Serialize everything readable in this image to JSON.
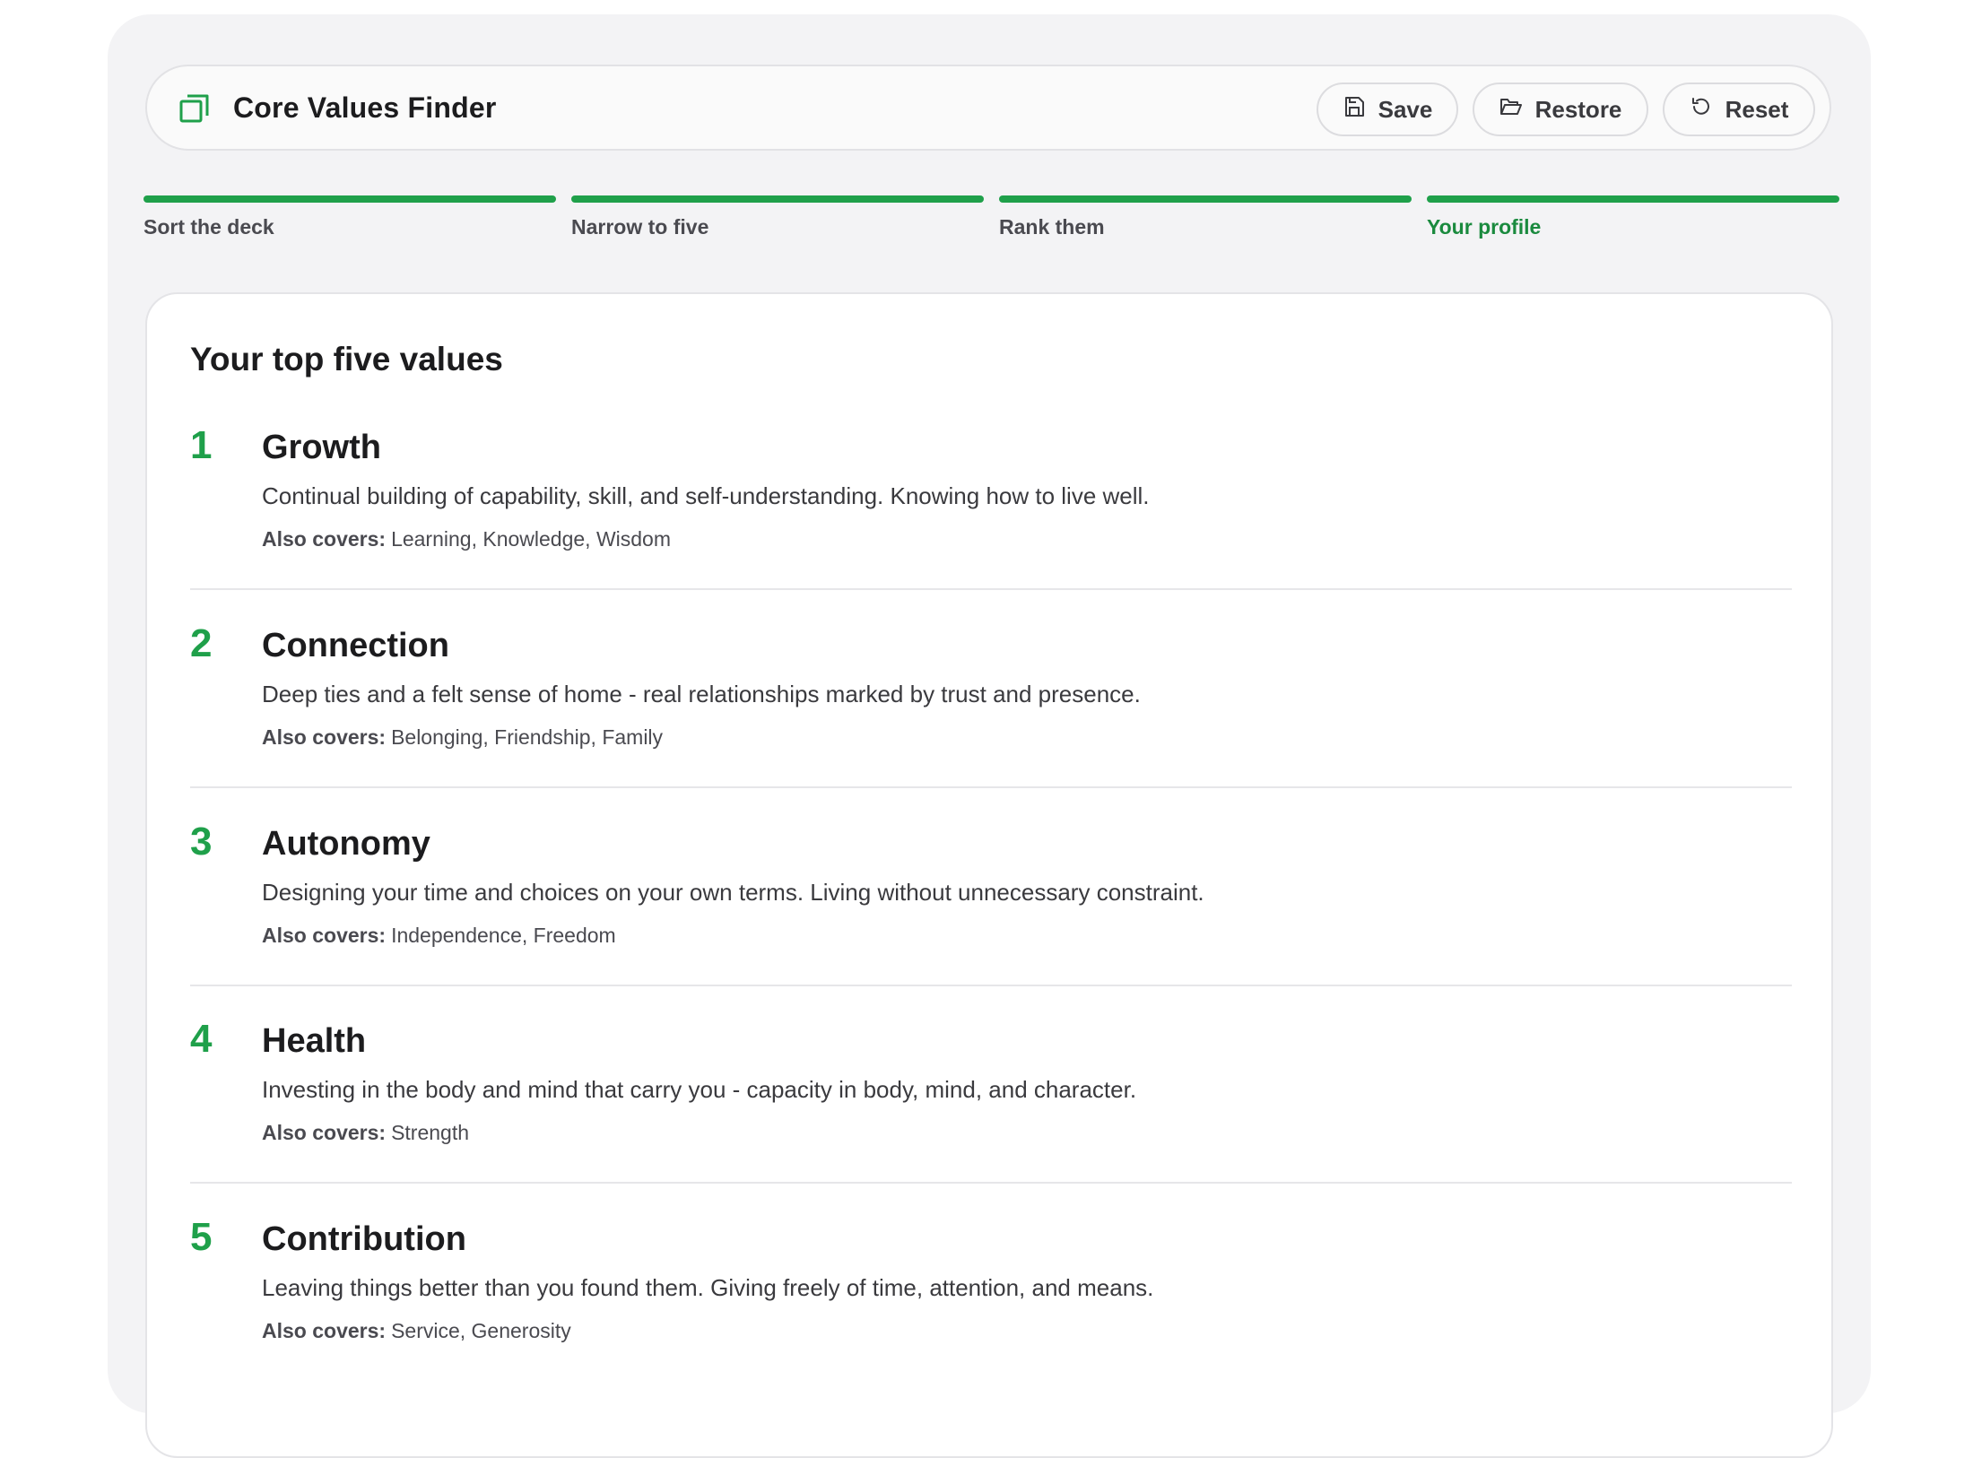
{
  "header": {
    "app_title": "Core Values Finder",
    "app_icon": "stacked-cards-icon",
    "buttons": {
      "save": "Save",
      "restore": "Restore",
      "reset": "Reset"
    }
  },
  "steps": [
    {
      "label": "Sort the deck",
      "active": false
    },
    {
      "label": "Narrow to five",
      "active": false
    },
    {
      "label": "Rank them",
      "active": false
    },
    {
      "label": "Your profile",
      "active": true
    }
  ],
  "profile": {
    "title": "Your top five values",
    "also_covers_label": "Also covers:",
    "values": [
      {
        "rank": "1",
        "name": "Growth",
        "description": "Continual building of capability, skill, and self-understanding. Knowing how to live well.",
        "also_covers": "Learning, Knowledge, Wisdom"
      },
      {
        "rank": "2",
        "name": "Connection",
        "description": "Deep ties and a felt sense of home - real relationships marked by trust and presence.",
        "also_covers": "Belonging, Friendship, Family"
      },
      {
        "rank": "3",
        "name": "Autonomy",
        "description": "Designing your time and choices on your own terms. Living without unnecessary constraint.",
        "also_covers": "Independence, Freedom"
      },
      {
        "rank": "4",
        "name": "Health",
        "description": "Investing in the body and mind that carry you - capacity in body, mind, and character.",
        "also_covers": "Strength"
      },
      {
        "rank": "5",
        "name": "Contribution",
        "description": "Leaving things better than you found them. Giving freely of time, attention, and means.",
        "also_covers": "Service, Generosity"
      }
    ]
  },
  "colors": {
    "accent": "#1fa04a",
    "accent_text": "#1a8a3e",
    "background": "#f3f3f5"
  }
}
